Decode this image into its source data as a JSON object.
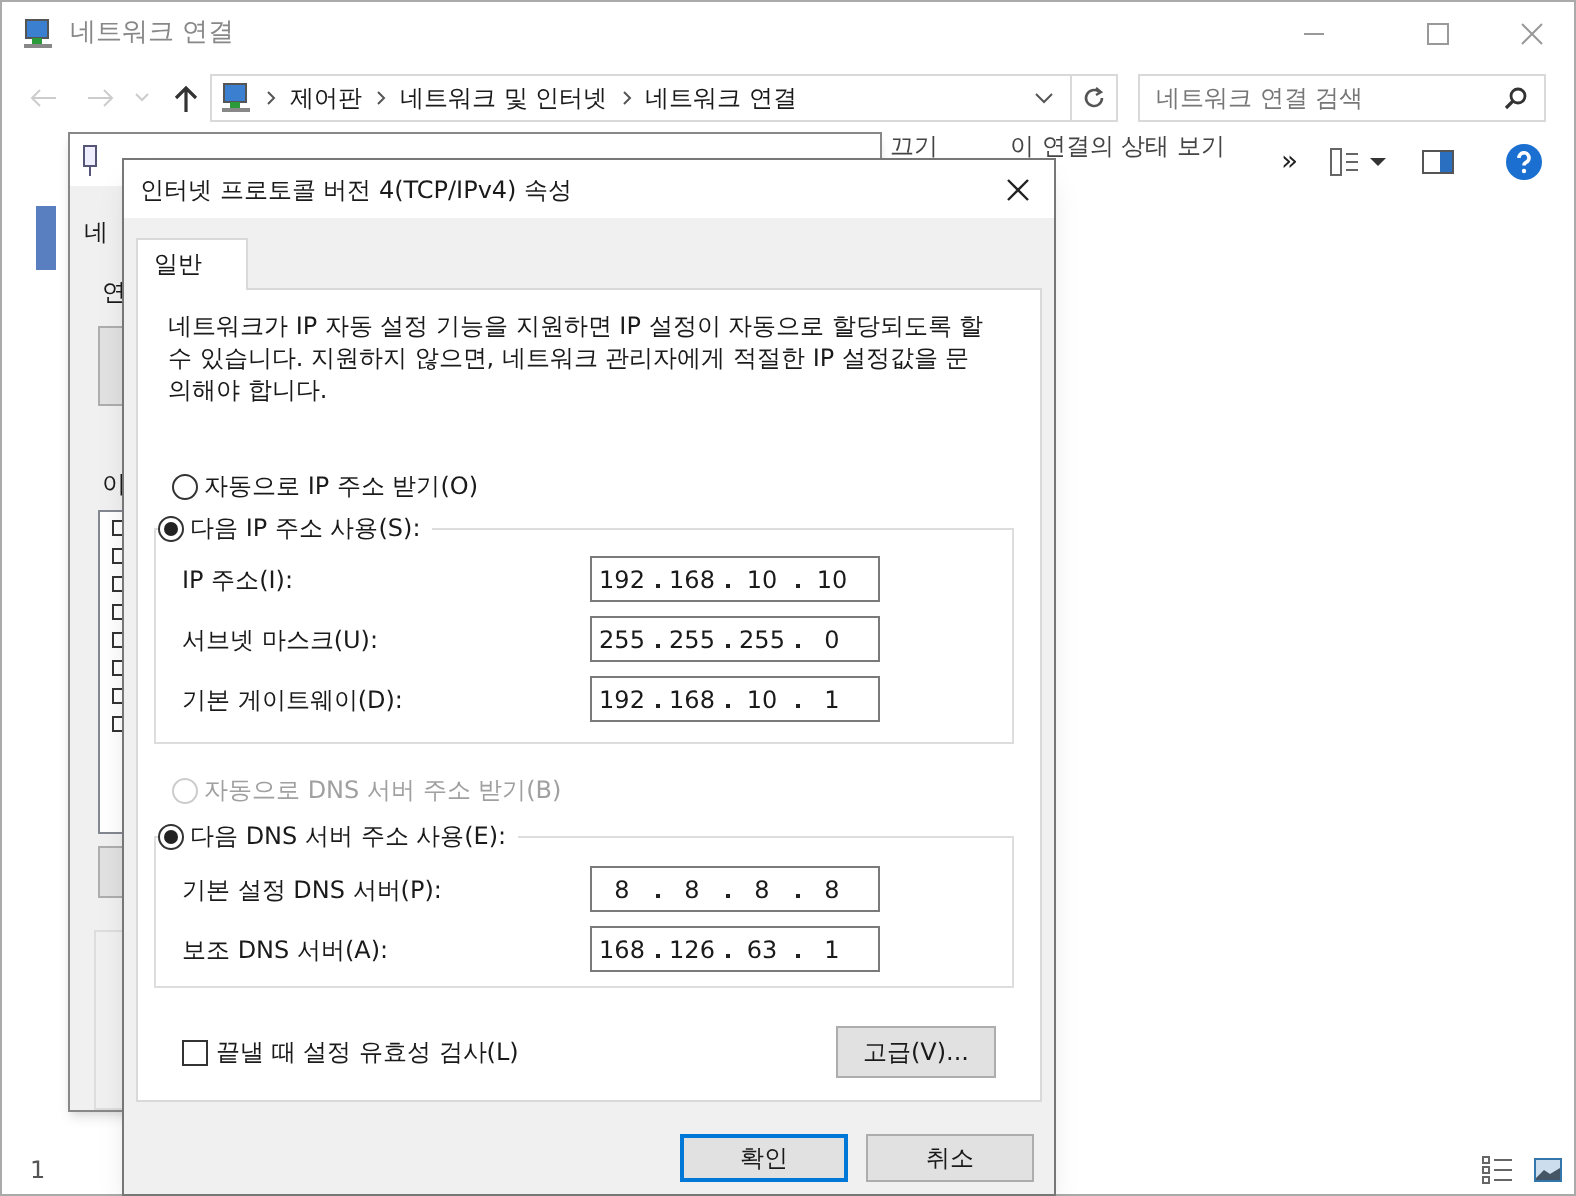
{
  "explorer": {
    "title": "네트워크 연결",
    "breadcrumb": [
      "제어판",
      "네트워크 및 인터넷",
      "네트워크 연결"
    ],
    "search": {
      "placeholder": "네트워크 연결 검색"
    },
    "toolbar": [
      "끄기",
      "이 연결의 상태 보기",
      "»"
    ],
    "status_bar": "1"
  },
  "back_window": {
    "fragments": [
      "네",
      "연",
      "이"
    ]
  },
  "dialog": {
    "title": "인터넷 프로토콜 버전 4(TCP/IPv4) 속성",
    "tabs": [
      {
        "label": "일반",
        "selected": true
      }
    ],
    "description": "네트워크가 IP 자동 설정 기능을 지원하면 IP 설정이 자동으로 할당되도록 할 수 있습니다. 지원하지 않으면, 네트워크 관리자에게 적절한 IP 설정값을 문의해야 합니다.",
    "ip_modes": [
      {
        "label": "자동으로 IP 주소 받기(O)",
        "selected": false,
        "disabled": false
      },
      {
        "label": "다음 IP 주소 사용(S):",
        "selected": true,
        "disabled": false
      }
    ],
    "ip_fields": [
      {
        "label": "IP 주소(I):",
        "value": [
          "192",
          "168",
          "10",
          "10"
        ]
      },
      {
        "label": "서브넷 마스크(U):",
        "value": [
          "255",
          "255",
          "255",
          "0"
        ]
      },
      {
        "label": "기본 게이트웨이(D):",
        "value": [
          "192",
          "168",
          "10",
          "1"
        ]
      }
    ],
    "dns_modes": [
      {
        "label": "자동으로 DNS 서버 주소 받기(B)",
        "selected": false,
        "disabled": true
      },
      {
        "label": "다음 DNS 서버 주소 사용(E):",
        "selected": true,
        "disabled": false
      }
    ],
    "dns_fields": [
      {
        "label": "기본 설정 DNS 서버(P):",
        "value": [
          "8",
          "8",
          "8",
          "8"
        ]
      },
      {
        "label": "보조 DNS 서버(A):",
        "value": [
          "168",
          "126",
          "63",
          "1"
        ]
      }
    ],
    "validate": {
      "label": "끝낼 때 설정 유효성 검사(L)",
      "checked": false
    },
    "advanced_button": "고급(V)...",
    "footer_buttons": [
      {
        "label": "확인",
        "default": true
      },
      {
        "label": "취소",
        "default": false
      }
    ]
  }
}
